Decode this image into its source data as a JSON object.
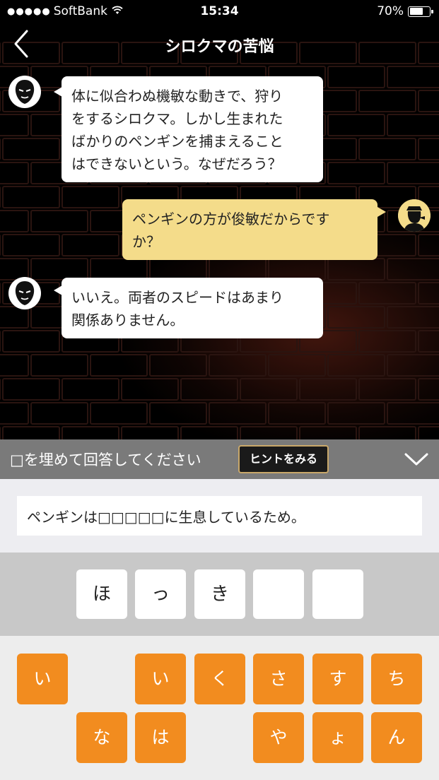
{
  "status_bar": {
    "carrier": "SoftBank",
    "time": "15:34",
    "battery": "70%",
    "battery_level": 0.7
  },
  "nav": {
    "title": "シロクマの苦悩",
    "back_icon": "chevron-left-icon"
  },
  "chat": [
    {
      "speaker": "host",
      "lines": [
        "体に似合わぬ機敏な動きで、狩り",
        "をするシロクマ。しかし生まれた",
        "ばかりのペンギンを捕まえること",
        "はできないという。なぜだろう？"
      ]
    },
    {
      "speaker": "player",
      "lines": [
        "ペンギンの方が俊敏だからです",
        "か？"
      ]
    },
    {
      "speaker": "host",
      "lines": [
        "いいえ。両者のスピードはあまり",
        "関係ありません。"
      ]
    }
  ],
  "prompt": {
    "text": "□を埋めて回答してください",
    "hint_label": "ヒントをみる",
    "collapse_icon": "chevron-down-icon"
  },
  "sentence": "ペンギンは□□□□□に生息しているため。",
  "slots": [
    "ほ",
    "っ",
    "き",
    "",
    ""
  ],
  "keys_row1": [
    "い",
    "",
    "い",
    "く",
    "さ",
    "す",
    "ち"
  ],
  "keys_row2": [
    "",
    "な",
    "は",
    "",
    "や",
    "ょ",
    "ん"
  ],
  "colors": {
    "key_orange": "#f28c1f",
    "player_bubble": "#f4dc8a",
    "hint_border": "#c9a86a"
  }
}
